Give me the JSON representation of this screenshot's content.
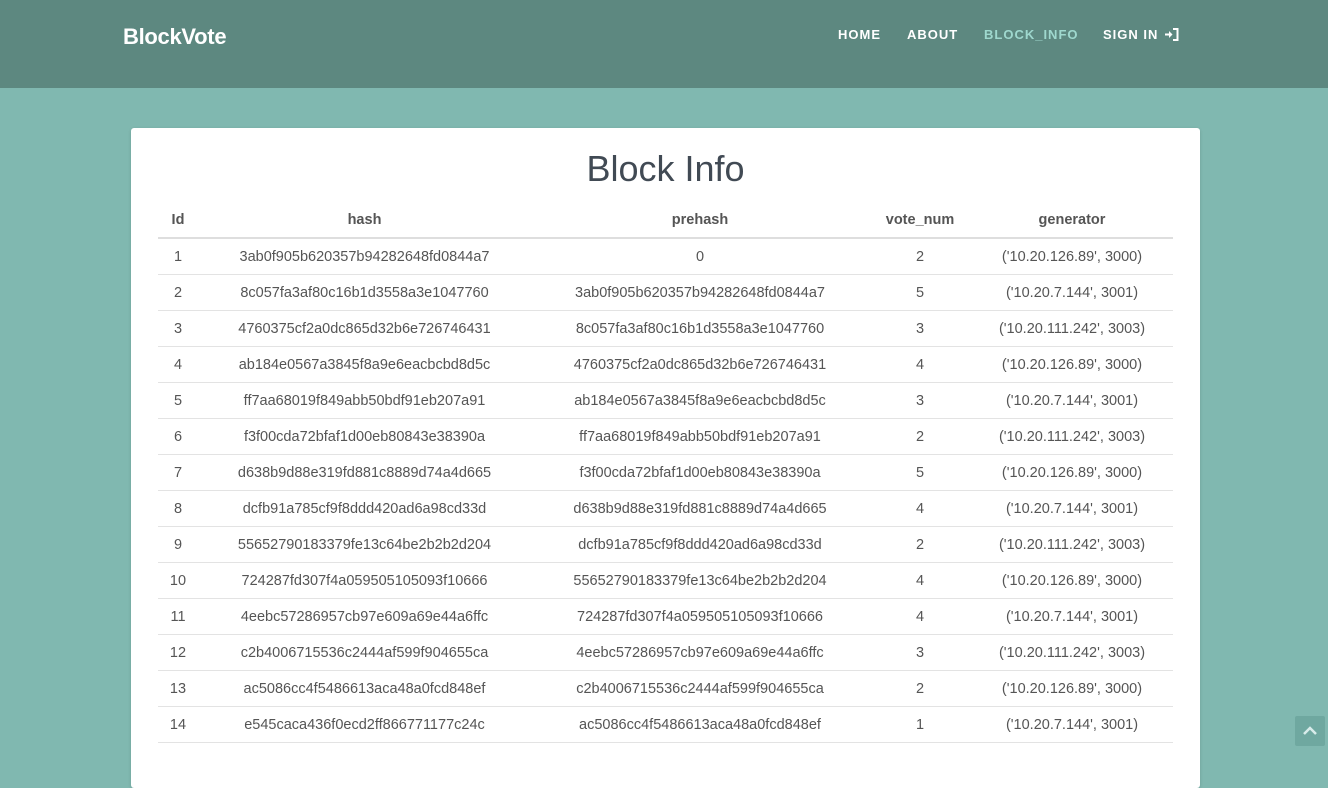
{
  "brand": "BlockVote",
  "nav": {
    "home": "HOME",
    "about": "ABOUT",
    "block_info": "BLOCK_INFO",
    "sign_in": "SIGN IN"
  },
  "page_title": "Block Info",
  "table": {
    "headers": [
      "Id",
      "hash",
      "prehash",
      "vote_num",
      "generator"
    ],
    "rows": [
      [
        "1",
        "3ab0f905b620357b94282648fd0844a7",
        "0",
        "2",
        "('10.20.126.89', 3000)"
      ],
      [
        "2",
        "8c057fa3af80c16b1d3558a3e1047760",
        "3ab0f905b620357b94282648fd0844a7",
        "5",
        "('10.20.7.144', 3001)"
      ],
      [
        "3",
        "4760375cf2a0dc865d32b6e726746431",
        "8c057fa3af80c16b1d3558a3e1047760",
        "3",
        "('10.20.111.242', 3003)"
      ],
      [
        "4",
        "ab184e0567a3845f8a9e6eacbcbd8d5c",
        "4760375cf2a0dc865d32b6e726746431",
        "4",
        "('10.20.126.89', 3000)"
      ],
      [
        "5",
        "ff7aa68019f849abb50bdf91eb207a91",
        "ab184e0567a3845f8a9e6eacbcbd8d5c",
        "3",
        "('10.20.7.144', 3001)"
      ],
      [
        "6",
        "f3f00cda72bfaf1d00eb80843e38390a",
        "ff7aa68019f849abb50bdf91eb207a91",
        "2",
        "('10.20.111.242', 3003)"
      ],
      [
        "7",
        "d638b9d88e319fd881c8889d74a4d665",
        "f3f00cda72bfaf1d00eb80843e38390a",
        "5",
        "('10.20.126.89', 3000)"
      ],
      [
        "8",
        "dcfb91a785cf9f8ddd420ad6a98cd33d",
        "d638b9d88e319fd881c8889d74a4d665",
        "4",
        "('10.20.7.144', 3001)"
      ],
      [
        "9",
        "55652790183379fe13c64be2b2b2d204",
        "dcfb91a785cf9f8ddd420ad6a98cd33d",
        "2",
        "('10.20.111.242', 3003)"
      ],
      [
        "10",
        "724287fd307f4a059505105093f10666",
        "55652790183379fe13c64be2b2b2d204",
        "4",
        "('10.20.126.89', 3000)"
      ],
      [
        "11",
        "4eebc57286957cb97e609a69e44a6ffc",
        "724287fd307f4a059505105093f10666",
        "4",
        "('10.20.7.144', 3001)"
      ],
      [
        "12",
        "c2b4006715536c2444af599f904655ca",
        "4eebc57286957cb97e609a69e44a6ffc",
        "3",
        "('10.20.111.242', 3003)"
      ],
      [
        "13",
        "ac5086cc4f5486613aca48a0fcd848ef",
        "c2b4006715536c2444af599f904655ca",
        "2",
        "('10.20.126.89', 3000)"
      ],
      [
        "14",
        "e545caca436f0ecd2ff866771177c24c",
        "ac5086cc4f5486613aca48a0fcd848ef",
        "1",
        "('10.20.7.144', 3001)"
      ]
    ]
  },
  "icons": {
    "sign_in": "sign-in-icon",
    "scroll_top": "chevron-up-icon"
  },
  "colors": {
    "header_bg": "#5d8880",
    "page_bg": "#80b8b0",
    "active_nav": "#9fd8ce",
    "title": "#414a54"
  }
}
